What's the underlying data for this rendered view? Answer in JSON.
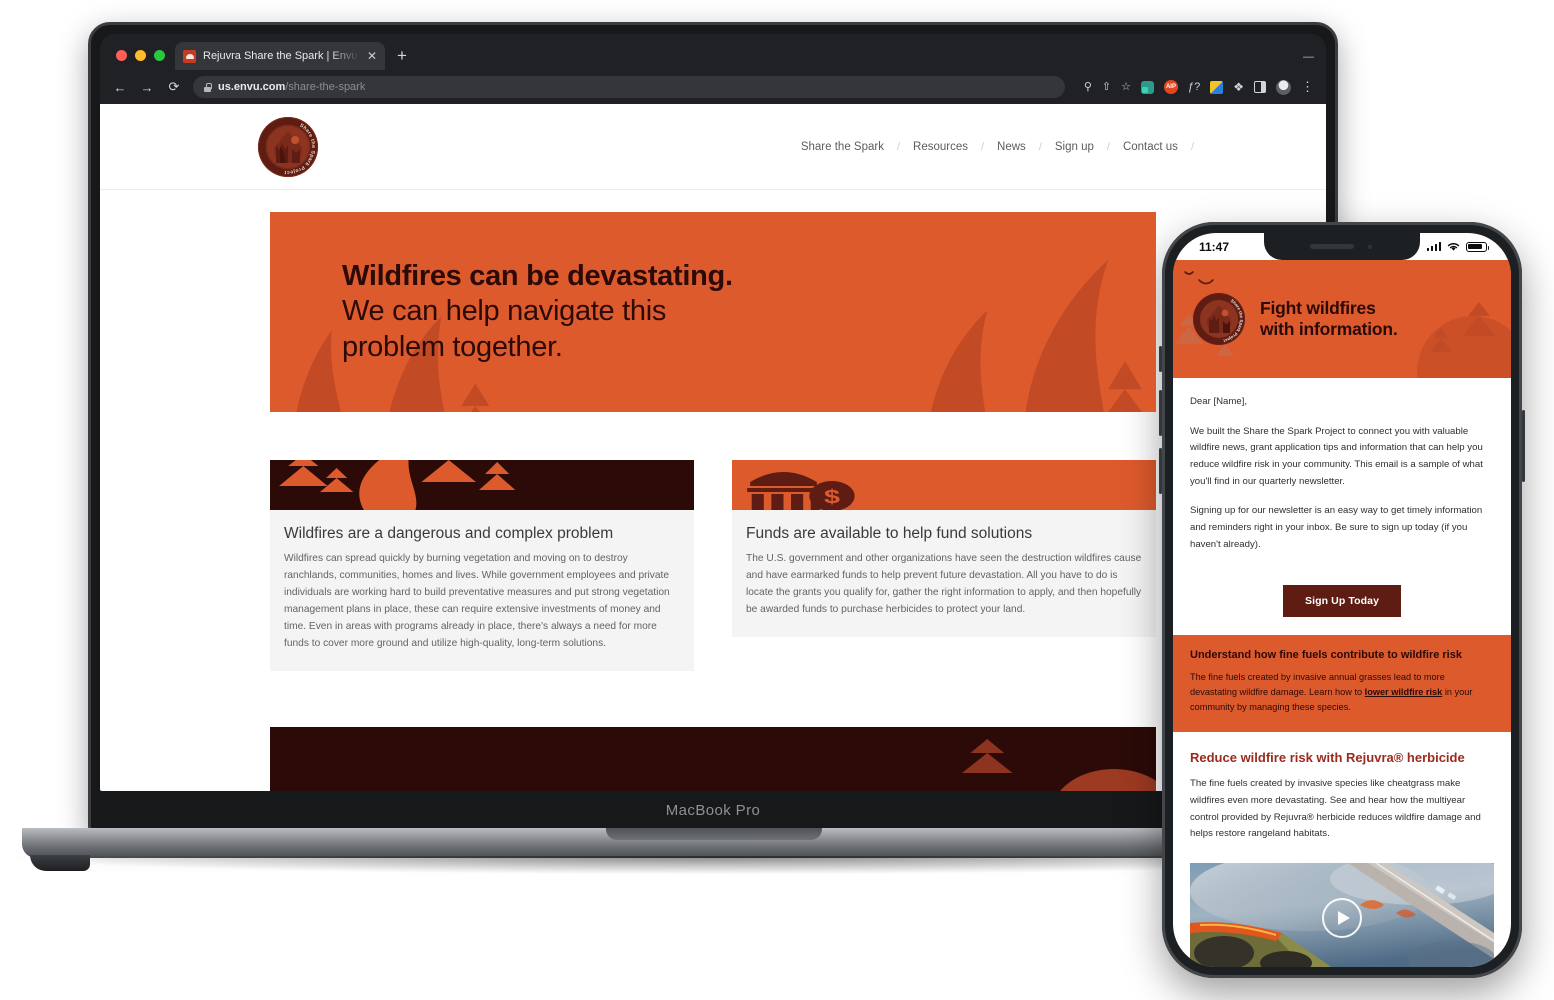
{
  "browser": {
    "tab": {
      "title": "Rejuvra Share the Spark | Envu",
      "favicon": "envu-favicon",
      "close_label": "✕"
    },
    "newtab_label": "+",
    "window_control_label": "—",
    "nav": {
      "back": "←",
      "forward": "→",
      "reload": "⟳"
    },
    "url_domain": "us.envu.com",
    "url_path": "/share-the-spark",
    "toolbar_icons": [
      "search-icon",
      "share-icon",
      "bookmark-star-icon",
      "extension-teal-icon",
      "extension-aip-icon",
      "extension-js-icon",
      "extension-colorful-icon",
      "extensions-puzzle-icon",
      "side-panel-icon",
      "profile-avatar",
      "chrome-menu-kebab"
    ],
    "ext_aip_label": "AIP",
    "ext_js_label": "ƒ?",
    "kebab_label": "⋮"
  },
  "laptop": {
    "model_label": "MacBook Pro"
  },
  "site": {
    "logo_alt": "Share the Spark Project",
    "logo_ring_top": "Share the Spark Project",
    "logo_ring_bottom": "Partnering for wildfire prevention",
    "nav_items": [
      "Share the Spark",
      "Resources",
      "News",
      "Sign up",
      "Contact us"
    ],
    "nav_separator": "/",
    "hero": {
      "line1": "Wildfires can be devastating.",
      "line2": "We can help navigate this",
      "line3": "problem together."
    },
    "cards": [
      {
        "art": "forest-trees-art",
        "title": "Wildfires are a dangerous and complex problem",
        "body": "Wildfires can spread quickly by burning vegetation and moving on to destroy ranchlands, communities, homes and lives. While government employees and private individuals are working hard to build preventative measures and put strong vegetation management plans in place, these can require extensive investments of money and time. Even in areas with programs already in place, there's always a need for more funds to cover more ground and utilize high-quality, long-term solutions."
      },
      {
        "art": "government-funding-art",
        "title": "Funds are available to help fund solutions",
        "body": "The U.S. government and other organizations have seen the destruction wildfires cause and have earmarked funds to help prevent future devastation. All you have to do is locate the grants you qualify for, gather the right information to apply, and then hopefully be awarded funds to purchase herbicides to protect your land."
      }
    ]
  },
  "phone": {
    "status": {
      "time": "11:47",
      "signal": "cellular-signal-icon",
      "wifi": "wifi-icon",
      "battery": "battery-icon"
    },
    "email": {
      "hero_line1": "Fight wildfires",
      "hero_line2": "with information.",
      "greeting": "Dear [Name],",
      "paragraph1": "We built the Share the Spark Project to connect you with valuable wildfire news, grant application tips and information that can help you reduce wildfire risk in your community. This email is a sample of what you'll find in our quarterly newsletter.",
      "paragraph2": "Signing up for our newsletter is an easy way to get timely information and reminders right in your inbox. Be sure to sign up today (if you haven't already).",
      "cta_label": "Sign Up Today",
      "band_title": "Understand how fine fuels contribute to wildfire risk",
      "band_text_before": "The fine fuels created by invasive annual grasses lead to more devastating wildfire damage. Learn how to ",
      "band_link": "lower wildfire risk",
      "band_text_after": " in your community by managing these species.",
      "section_title": "Reduce wildfire risk with Rejuvra® herbicide",
      "section_text": "The fine fuels created by invasive species like cheatgrass make wildfires even more devastating. See and hear how the multiyear control provided by Rejuvra® herbicide reduces wildfire damage and helps restore rangeland habitats.",
      "video_alt": "aerial-wildfire-highway-video-thumbnail",
      "play_label": "play-button"
    }
  },
  "colors": {
    "brand_orange": "#dd5a2d",
    "brand_dark_maroon": "#2b0a07",
    "brand_red": "#9c2a1e",
    "badge_maroon": "#5e1c13",
    "card_bg": "#f4f4f4"
  }
}
